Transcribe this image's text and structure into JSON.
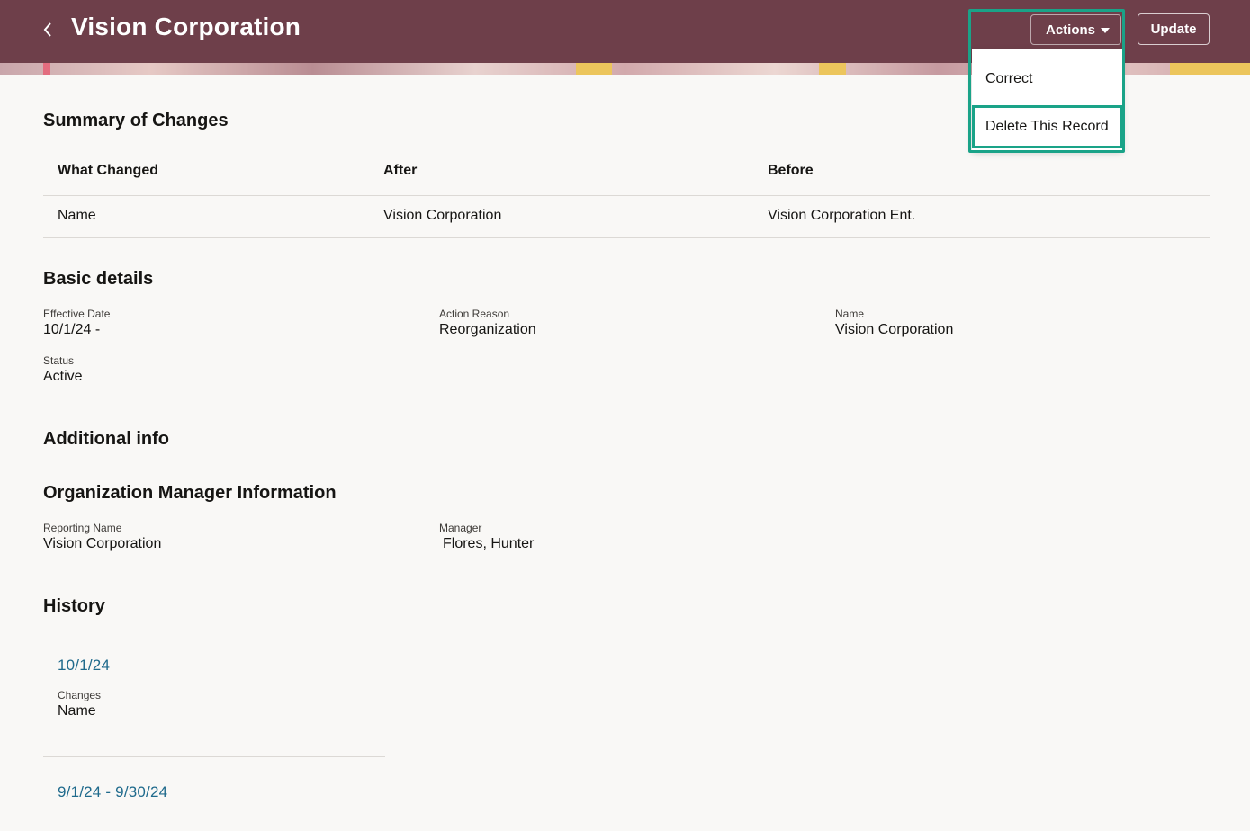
{
  "header": {
    "title": "Vision Corporation",
    "actions_label": "Actions",
    "update_label": "Update"
  },
  "actions_menu": {
    "items": [
      {
        "label": "Correct"
      },
      {
        "label": "Delete This Record"
      }
    ]
  },
  "summary": {
    "title": "Summary of Changes",
    "columns": [
      "What Changed",
      "After",
      "Before"
    ],
    "rows": [
      [
        "Name",
        "Vision Corporation",
        "Vision Corporation Ent."
      ]
    ]
  },
  "basic_details": {
    "title": "Basic details",
    "fields": [
      {
        "label": "Effective Date",
        "value": "10/1/24 -"
      },
      {
        "label": "Action Reason",
        "value": "Reorganization"
      },
      {
        "label": "Name",
        "value": "Vision Corporation"
      },
      {
        "label": "Status",
        "value": "Active"
      }
    ]
  },
  "additional_info": {
    "title": "Additional info"
  },
  "org_manager": {
    "title": "Organization Manager Information",
    "fields": [
      {
        "label": "Reporting Name",
        "value": "Vision Corporation"
      },
      {
        "label": "Manager",
        "value": "Flores, Hunter"
      }
    ]
  },
  "history": {
    "title": "History",
    "entries": [
      {
        "date": "10/1/24",
        "changes_label": "Changes",
        "changes_value": "Name"
      },
      {
        "date": "9/1/24 - 9/30/24"
      }
    ]
  },
  "colors": {
    "header_bg": "#6e3f4a",
    "highlight": "#1aa388",
    "link": "#1f6a8c",
    "page_bg": "#f9f8f6"
  }
}
